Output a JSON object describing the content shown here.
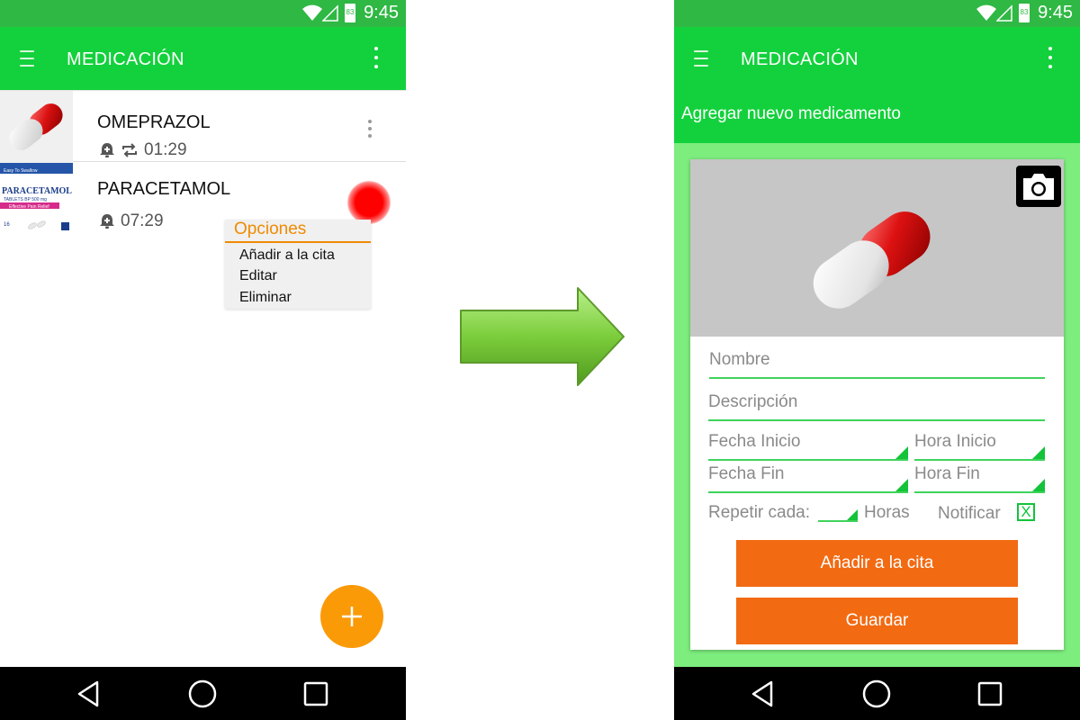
{
  "status_bar": {
    "time": "9:45",
    "battery_level": "83"
  },
  "left_screen": {
    "app_bar": {
      "title": "MEDICACIÓN"
    },
    "medications": [
      {
        "name": "OMEPRAZOL",
        "time": "01:29",
        "image": "red-white-capsule"
      },
      {
        "name": "PARACETAMOL",
        "time": "07:29",
        "image": "paracetamol-box"
      }
    ],
    "box_text": {
      "top": "Easy To Swallow",
      "brand": "PARACETAMOL",
      "sub": "TABLETS BP 500 mg",
      "band": "Effective Pain Relief",
      "count": "16"
    },
    "popup": {
      "title": "Opciones",
      "items": [
        "Añadir a la cita",
        "Editar",
        "Eliminar"
      ]
    }
  },
  "right_screen": {
    "app_bar": {
      "title": "MEDICACIÓN"
    },
    "subheader": "Agregar nuevo medicamento",
    "form": {
      "nombre": "Nombre",
      "descripcion": "Descripción",
      "fecha_inicio": "Fecha Inicio",
      "hora_inicio": "Hora Inicio",
      "fecha_fin": "Fecha Fin",
      "hora_fin": "Hora Fin",
      "repetir_cada": "Repetir cada:",
      "horas": "Horas",
      "notificar": "Notificar",
      "notificar_mark": "X",
      "btn_cita": "Añadir a la cita",
      "btn_guardar": "Guardar"
    }
  },
  "colors": {
    "status_bar": "#2fb844",
    "app_bar": "#13d13c",
    "form_background": "#7ded7e",
    "accent_orange": "#f26a12",
    "fab": "#fb9a07",
    "popup_title": "#f08a00"
  },
  "icons": [
    "menu-icon",
    "overflow-icon",
    "alarm-icon",
    "repeat-icon",
    "camera-icon",
    "add-icon",
    "back-icon",
    "home-icon",
    "recent-apps-icon",
    "wifi-icon",
    "signal-icon",
    "battery-icon",
    "arrow-right-icon"
  ]
}
